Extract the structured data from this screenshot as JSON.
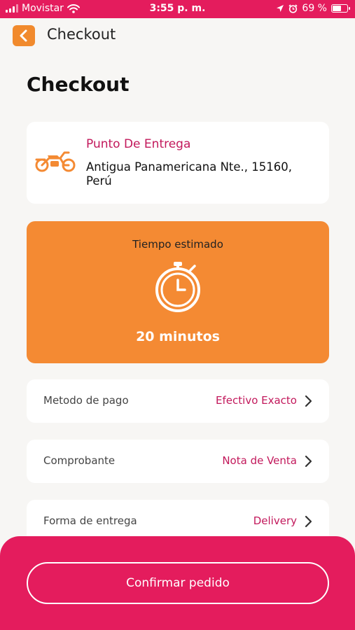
{
  "status_bar": {
    "carrier": "Movistar",
    "time": "3:55 p. m.",
    "battery": "69 %",
    "battery_level": 0.69
  },
  "nav": {
    "title": "Checkout"
  },
  "page": {
    "title": "Checkout"
  },
  "delivery": {
    "label": "Punto De Entrega",
    "address": "Antigua Panamericana Nte., 15160, Perú"
  },
  "estimate": {
    "label": "Tiempo estimado",
    "value": "20 minutos"
  },
  "options": [
    {
      "label": "Metodo de pago",
      "value": "Efectivo Exacto"
    },
    {
      "label": "Comprobante",
      "value": "Nota de Venta"
    },
    {
      "label": "Forma de entrega",
      "value": "Delivery"
    }
  ],
  "footer": {
    "confirm_label": "Confirmar pedido"
  },
  "colors": {
    "brand_pink": "#e41c5d",
    "accent_orange": "#f48a33",
    "value_text": "#c2185b"
  }
}
